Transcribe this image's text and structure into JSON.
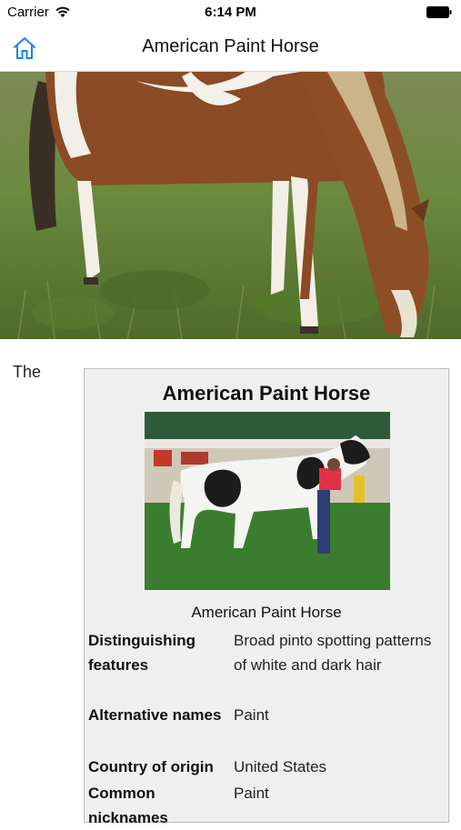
{
  "status": {
    "carrier": "Carrier",
    "time": "6:14 PM"
  },
  "nav": {
    "title": "American Paint Horse",
    "home_icon": "home-icon"
  },
  "article": {
    "intro_text": "The"
  },
  "infobox": {
    "title": "American Paint Horse",
    "caption": "American Paint Horse",
    "rows": [
      {
        "label": "Distinguishing features",
        "value": "Broad pinto spotting patterns of white and dark hair"
      },
      {
        "label": "Alternative names",
        "value": "Paint"
      },
      {
        "label": "Country of origin",
        "value": "United States"
      },
      {
        "label": "Common nicknames",
        "value": "Paint"
      }
    ]
  }
}
